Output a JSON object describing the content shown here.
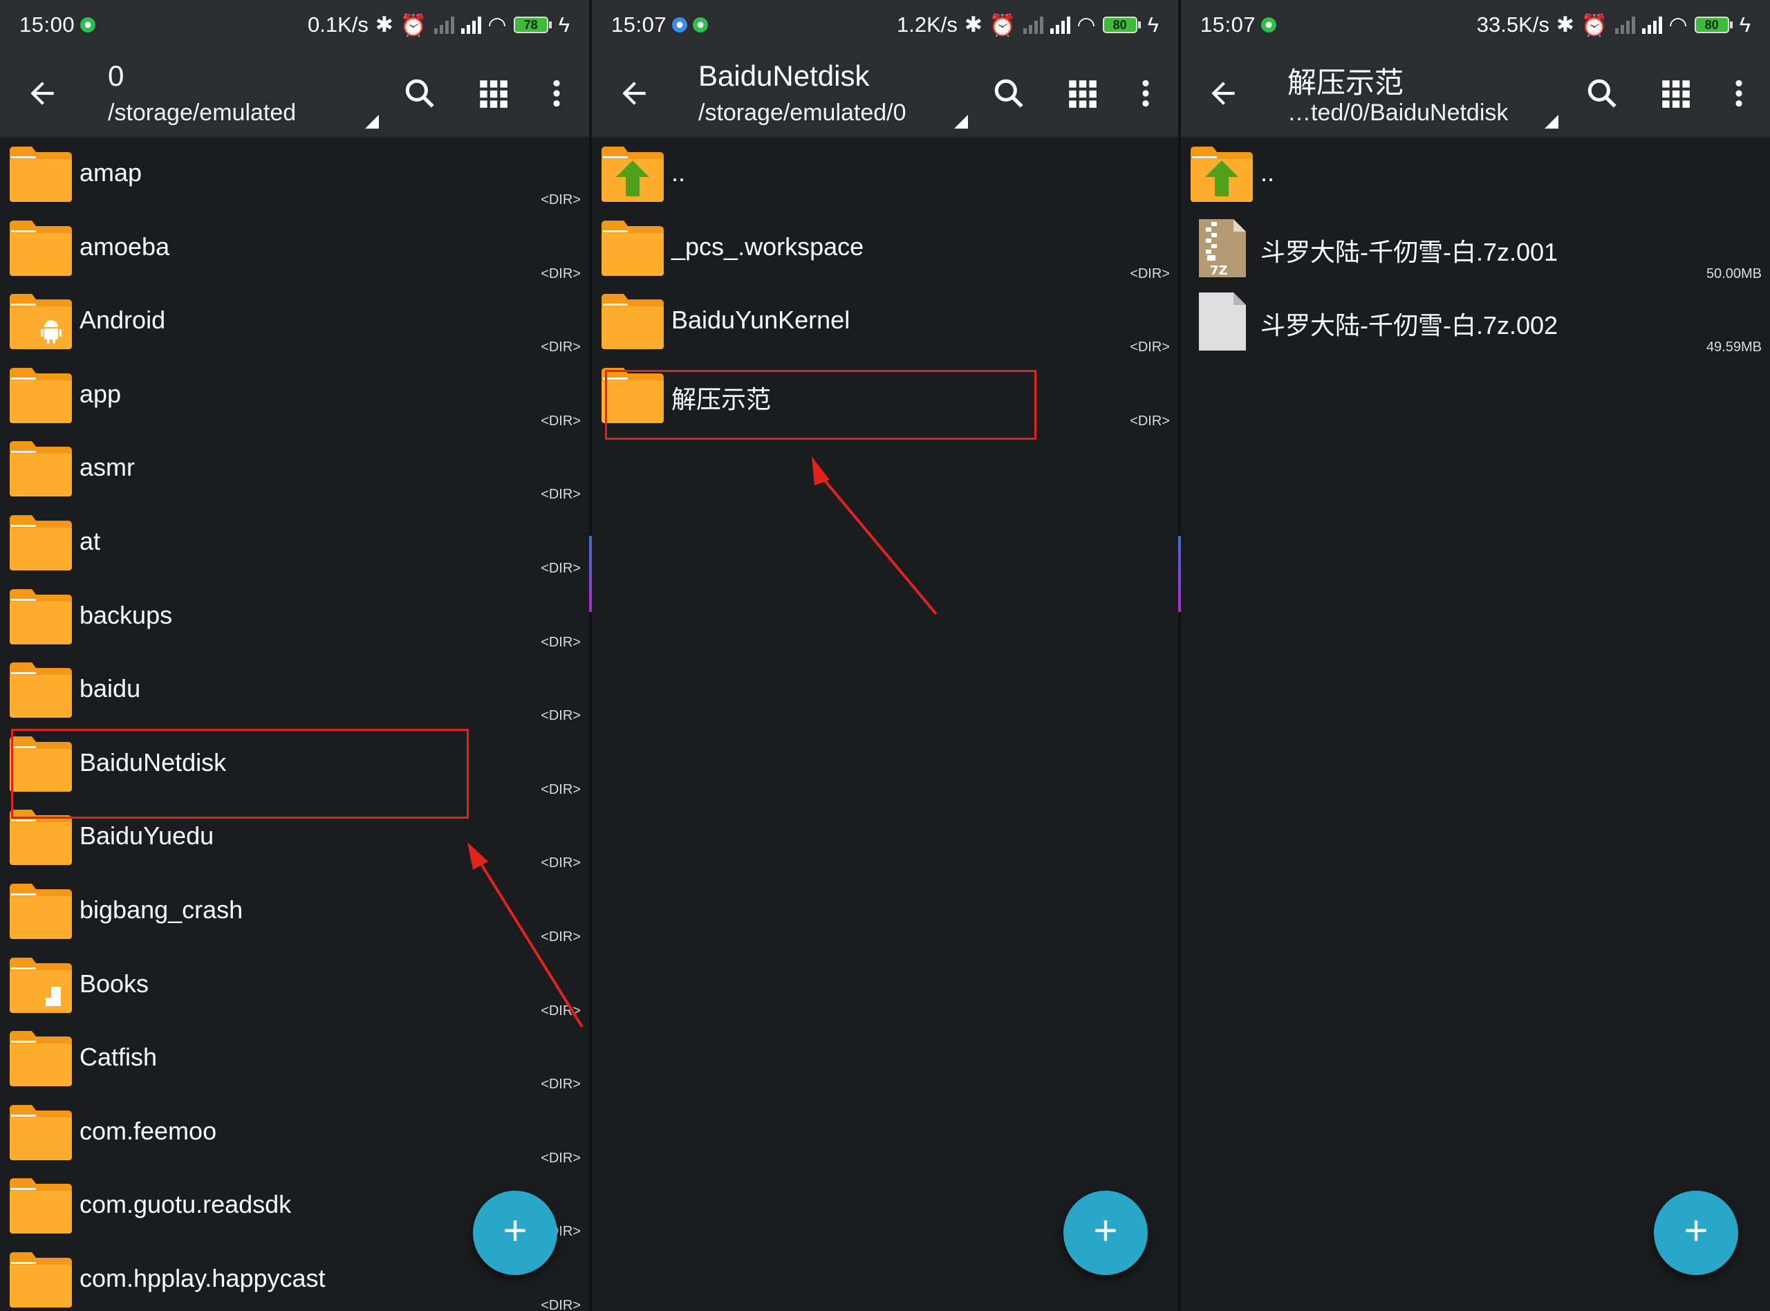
{
  "panels": [
    {
      "status": {
        "time": "15:00",
        "speed": "0.1K/s",
        "battery": "78"
      },
      "toolbar": {
        "title": "0",
        "path": "/storage/emulated"
      },
      "items": [
        {
          "name": "amap",
          "meta": "<DIR>",
          "icon": "folder"
        },
        {
          "name": "amoeba",
          "meta": "<DIR>",
          "icon": "folder"
        },
        {
          "name": "Android",
          "meta": "<DIR>",
          "icon": "folder-android"
        },
        {
          "name": "app",
          "meta": "<DIR>",
          "icon": "folder"
        },
        {
          "name": "asmr",
          "meta": "<DIR>",
          "icon": "folder"
        },
        {
          "name": "at",
          "meta": "<DIR>",
          "icon": "folder"
        },
        {
          "name": "backups",
          "meta": "<DIR>",
          "icon": "folder"
        },
        {
          "name": "baidu",
          "meta": "<DIR>",
          "icon": "folder"
        },
        {
          "name": "BaiduNetdisk",
          "meta": "<DIR>",
          "icon": "folder"
        },
        {
          "name": "BaiduYuedu",
          "meta": "<DIR>",
          "icon": "folder"
        },
        {
          "name": "bigbang_crash",
          "meta": "<DIR>",
          "icon": "folder"
        },
        {
          "name": "Books",
          "meta": "<DIR>",
          "icon": "folder-books"
        },
        {
          "name": "Catfish",
          "meta": "<DIR>",
          "icon": "folder"
        },
        {
          "name": "com.feemoo",
          "meta": "<DIR>",
          "icon": "folder"
        },
        {
          "name": "com.guotu.readsdk",
          "meta": "<DIR>",
          "icon": "folder"
        },
        {
          "name": "com.hpplay.happycast",
          "meta": "<DIR>",
          "icon": "folder"
        }
      ]
    },
    {
      "status": {
        "time": "15:07",
        "speed": "1.2K/s",
        "battery": "80"
      },
      "toolbar": {
        "title": "BaiduNetdisk",
        "path": "/storage/emulated/0"
      },
      "items": [
        {
          "name": "..",
          "meta": "",
          "icon": "folder-up"
        },
        {
          "name": "_pcs_.workspace",
          "meta": "<DIR>",
          "icon": "folder"
        },
        {
          "name": "BaiduYunKernel",
          "meta": "<DIR>",
          "icon": "folder"
        },
        {
          "name": "解压示范",
          "meta": "<DIR>",
          "icon": "folder"
        }
      ]
    },
    {
      "status": {
        "time": "15:07",
        "speed": "33.5K/s",
        "battery": "80"
      },
      "toolbar": {
        "title": "解压示范",
        "path": "…ted/0/BaiduNetdisk"
      },
      "items": [
        {
          "name": "..",
          "meta": "",
          "icon": "folder-up"
        },
        {
          "name": "斗罗大陆-千仞雪-白.7z.001",
          "meta": "50.00MB",
          "icon": "archive-7z"
        },
        {
          "name": "斗罗大陆-千仞雪-白.7z.002",
          "meta": "49.59MB",
          "icon": "file-generic"
        }
      ]
    }
  ],
  "fab_label": "+",
  "colors": {
    "folder": "#f7a21b",
    "folder_light": "#ffc04a",
    "accent_fab": "#2aa6c9",
    "highlight": "#e0231c",
    "toolbar": "#2c2d30",
    "background": "#1b1c1f"
  }
}
